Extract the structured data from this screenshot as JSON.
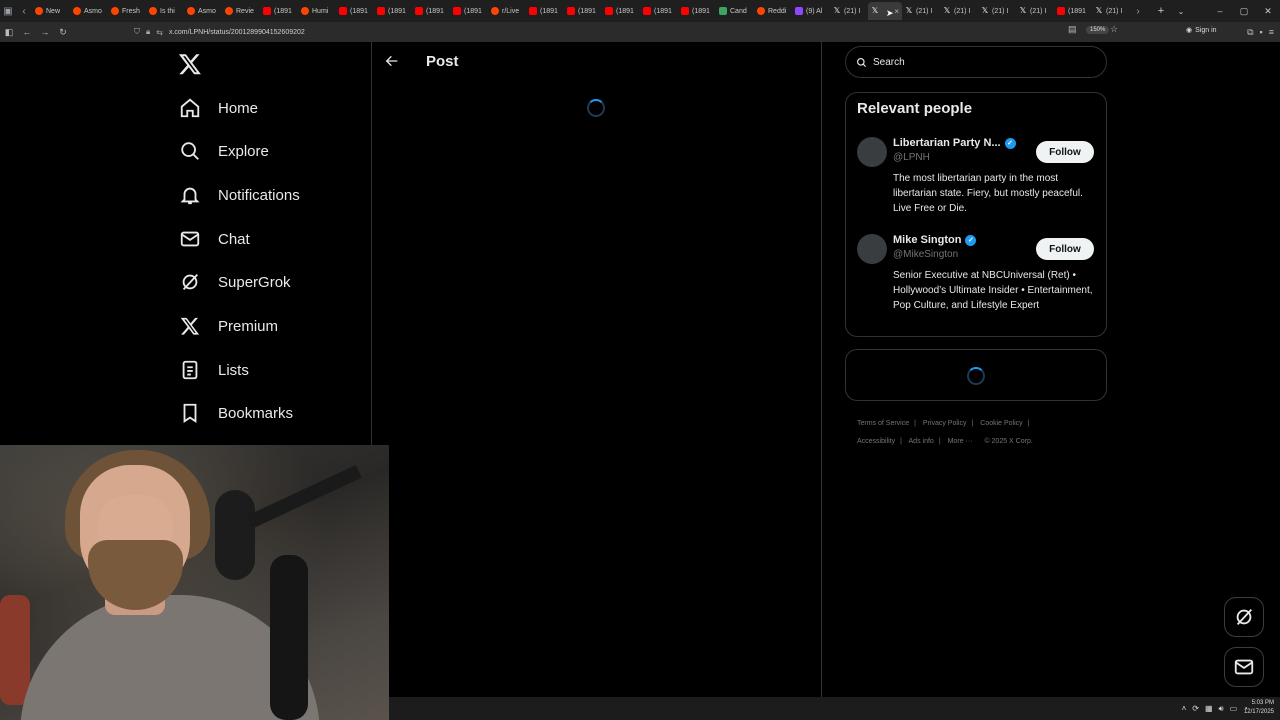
{
  "browser": {
    "tabs": [
      {
        "label": "New",
        "icon": "reddit-icon"
      },
      {
        "label": "Asmo",
        "icon": "reddit-icon"
      },
      {
        "label": "Fresh",
        "icon": "reddit-icon"
      },
      {
        "label": "Is thi",
        "icon": "reddit-icon"
      },
      {
        "label": "Asmo",
        "icon": "reddit-icon"
      },
      {
        "label": "Revie",
        "icon": "reddit-icon"
      },
      {
        "label": "(1891",
        "icon": "youtube-icon"
      },
      {
        "label": "Humi",
        "icon": "reddit-icon"
      },
      {
        "label": "(1891",
        "icon": "youtube-icon"
      },
      {
        "label": "(1891",
        "icon": "youtube-icon"
      },
      {
        "label": "(1891",
        "icon": "youtube-icon"
      },
      {
        "label": "(1891",
        "icon": "youtube-icon"
      },
      {
        "label": "r/Live",
        "icon": "reddit-icon"
      },
      {
        "label": "(1891",
        "icon": "youtube-icon"
      },
      {
        "label": "(1891",
        "icon": "youtube-icon"
      },
      {
        "label": "(1891",
        "icon": "youtube-icon"
      },
      {
        "label": "(1891",
        "icon": "youtube-icon"
      },
      {
        "label": "(1891",
        "icon": "youtube-icon"
      },
      {
        "label": "Cand",
        "icon": "candle-icon"
      },
      {
        "label": "Reddi",
        "icon": "reddit-icon"
      },
      {
        "label": "(9) Al",
        "icon": "twitch-icon"
      },
      {
        "label": "(21) I",
        "icon": "x-icon"
      }
    ],
    "active_tab": {
      "label": "",
      "close": "×"
    },
    "tabs_after": [
      {
        "label": "(21) I",
        "icon": "x-icon"
      },
      {
        "label": "(21) I",
        "icon": "x-icon"
      },
      {
        "label": "(21) I",
        "icon": "x-icon"
      },
      {
        "label": "(21) I",
        "icon": "x-icon"
      },
      {
        "label": "(1891",
        "icon": "youtube-icon"
      },
      {
        "label": "(21) I",
        "icon": "x-icon"
      }
    ],
    "url": "x.com/LPNH/status/2001289904152609202",
    "zoom": "150%",
    "sign_in": "Sign in"
  },
  "sidebar": {
    "items": [
      {
        "label": "Home",
        "icon": "home-icon"
      },
      {
        "label": "Explore",
        "icon": "search-icon"
      },
      {
        "label": "Notifications",
        "icon": "bell-icon"
      },
      {
        "label": "Chat",
        "icon": "mail-icon"
      },
      {
        "label": "SuperGrok",
        "icon": "grok-icon"
      },
      {
        "label": "Premium",
        "icon": "x-icon"
      },
      {
        "label": "Lists",
        "icon": "list-icon"
      },
      {
        "label": "Bookmarks",
        "icon": "bookmark-icon"
      }
    ]
  },
  "main": {
    "title": "Post"
  },
  "right": {
    "search_placeholder": "Search",
    "relevant_title": "Relevant people",
    "people": [
      {
        "name": "Libertarian Party N...",
        "handle": "@LPNH",
        "bio": "The most libertarian party in the most libertarian state. Fiery, but mostly peaceful. Live Free or Die.",
        "follow": "Follow",
        "verified": true
      },
      {
        "name": "Mike Sington",
        "handle": "@MikeSington",
        "bio": "Senior Executive at NBCUniversal (Ret) • Hollywood’s Ultimate Insider • Entertainment, Pop Culture, and Lifestyle Expert",
        "follow": "Follow",
        "verified": true
      }
    ],
    "footer": {
      "terms": "Terms of Service",
      "privacy": "Privacy Policy",
      "cookie": "Cookie Policy",
      "accessibility": "Accessibility",
      "ads": "Ads info",
      "more": "More ···",
      "copyright": "© 2025 X Corp."
    }
  },
  "taskbar": {
    "time": "5:03 PM",
    "date": "12/17/2025"
  },
  "colors": {
    "accent": "#1d9bf0",
    "background": "#000000",
    "border": "#2f3336",
    "muted": "#71767b"
  }
}
